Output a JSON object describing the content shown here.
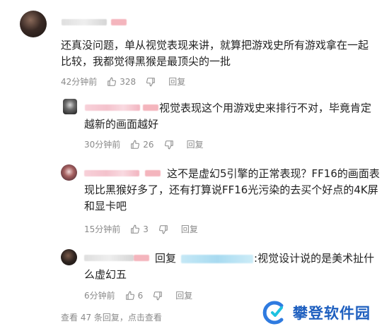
{
  "comments": [
    {
      "text": "还真没问题，单从视觉表现来讲，就算把游戏史所有游戏拿在一起比较，我都觉得黑猴是最顶尖的一批",
      "time": "42分钟前",
      "likes": "328",
      "reply_label": "回复"
    },
    {
      "text": "视觉表现这个用游戏史来排行不对，毕竟肯定越新的画面越好",
      "time": "30分钟前",
      "likes": "26",
      "reply_label": "回复"
    },
    {
      "text": "这不是虚幻5引擎的正常表现？FF16的画面表现比黑猴好多了，还有打算说FF16光污染的去买个好点的4K屏和显卡吧",
      "time": "15分钟前",
      "likes": "3",
      "reply_label": "回复"
    },
    {
      "reply_prefix": "回复",
      "text": ":视觉设计说的是美术扯什么虚幻五",
      "time": "6分钟前",
      "likes": "6",
      "reply_label": "回复"
    }
  ],
  "view_more": "查看 47 条回复，点击查看",
  "watermark": "攀登软件园",
  "colors": {
    "text": "#222222",
    "meta": "#8a8a8a",
    "watermark": "#1e5fbf"
  },
  "icons": [
    "thumbs-up-icon",
    "thumbs-down-icon",
    "avatar"
  ]
}
